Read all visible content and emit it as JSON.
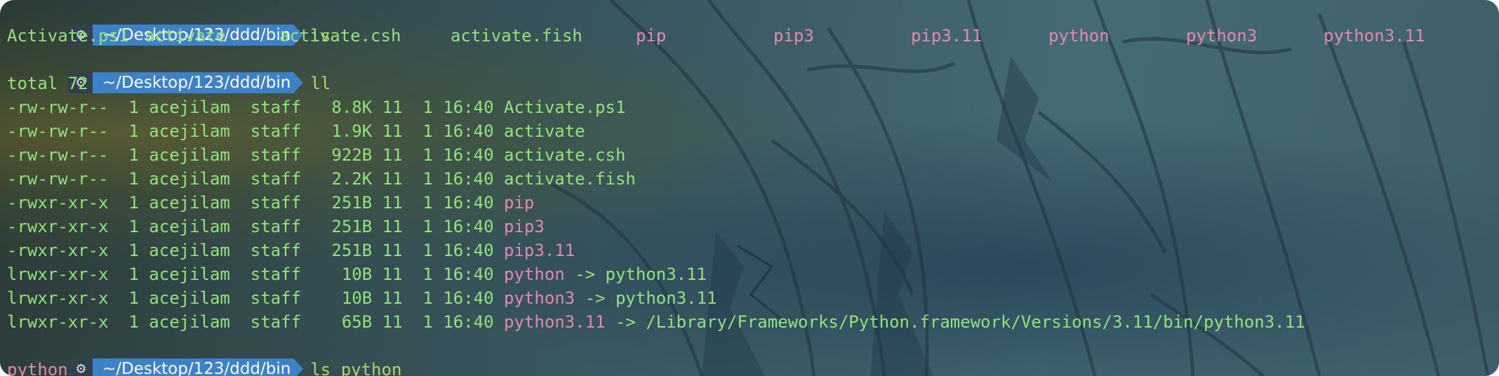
{
  "prompt": {
    "os_icon": "gear-icon",
    "path": "~/Desktop/123/ddd/bin"
  },
  "commands": {
    "c1": "ls",
    "c2": "ll",
    "c3_cmd": "ls",
    "c3_arg": "python"
  },
  "ls_output": [
    {
      "name": "Activate.ps1",
      "kind": "file"
    },
    {
      "name": "activate",
      "kind": "file"
    },
    {
      "name": "activate.csh",
      "kind": "file"
    },
    {
      "name": "activate.fish",
      "kind": "file"
    },
    {
      "name": "pip",
      "kind": "exec"
    },
    {
      "name": "pip3",
      "kind": "exec"
    },
    {
      "name": "pip3.11",
      "kind": "exec"
    },
    {
      "name": "python",
      "kind": "exec"
    },
    {
      "name": "python3",
      "kind": "exec"
    },
    {
      "name": "python3.11",
      "kind": "exec"
    }
  ],
  "ll_output": {
    "total": "total 72",
    "rows": [
      {
        "meta": "-rw-rw-r--  1 acejilam  staff   8.8K 11  1 16:40 ",
        "name": "Activate.ps1",
        "kind": "file",
        "target": ""
      },
      {
        "meta": "-rw-rw-r--  1 acejilam  staff   1.9K 11  1 16:40 ",
        "name": "activate",
        "kind": "file",
        "target": ""
      },
      {
        "meta": "-rw-rw-r--  1 acejilam  staff   922B 11  1 16:40 ",
        "name": "activate.csh",
        "kind": "file",
        "target": ""
      },
      {
        "meta": "-rw-rw-r--  1 acejilam  staff   2.2K 11  1 16:40 ",
        "name": "activate.fish",
        "kind": "file",
        "target": ""
      },
      {
        "meta": "-rwxr-xr-x  1 acejilam  staff   251B 11  1 16:40 ",
        "name": "pip",
        "kind": "exec",
        "target": ""
      },
      {
        "meta": "-rwxr-xr-x  1 acejilam  staff   251B 11  1 16:40 ",
        "name": "pip3",
        "kind": "exec",
        "target": ""
      },
      {
        "meta": "-rwxr-xr-x  1 acejilam  staff   251B 11  1 16:40 ",
        "name": "pip3.11",
        "kind": "exec",
        "target": ""
      },
      {
        "meta": "lrwxr-xr-x  1 acejilam  staff    10B 11  1 16:40 ",
        "name": "python",
        "kind": "exec",
        "target": " -> python3.11"
      },
      {
        "meta": "lrwxr-xr-x  1 acejilam  staff    10B 11  1 16:40 ",
        "name": "python3",
        "kind": "exec",
        "target": " -> python3.11"
      },
      {
        "meta": "lrwxr-xr-x  1 acejilam  staff    65B 11  1 16:40 ",
        "name": "python3.11",
        "kind": "exec",
        "target": " -> /Library/Frameworks/Python.framework/Versions/3.11/bin/python3.11"
      }
    ]
  },
  "last_output": "python",
  "colors": {
    "file": "#93e27e",
    "exec": "#e28aab",
    "command": "#b3d36a",
    "path_segment": "#3d82c8"
  }
}
